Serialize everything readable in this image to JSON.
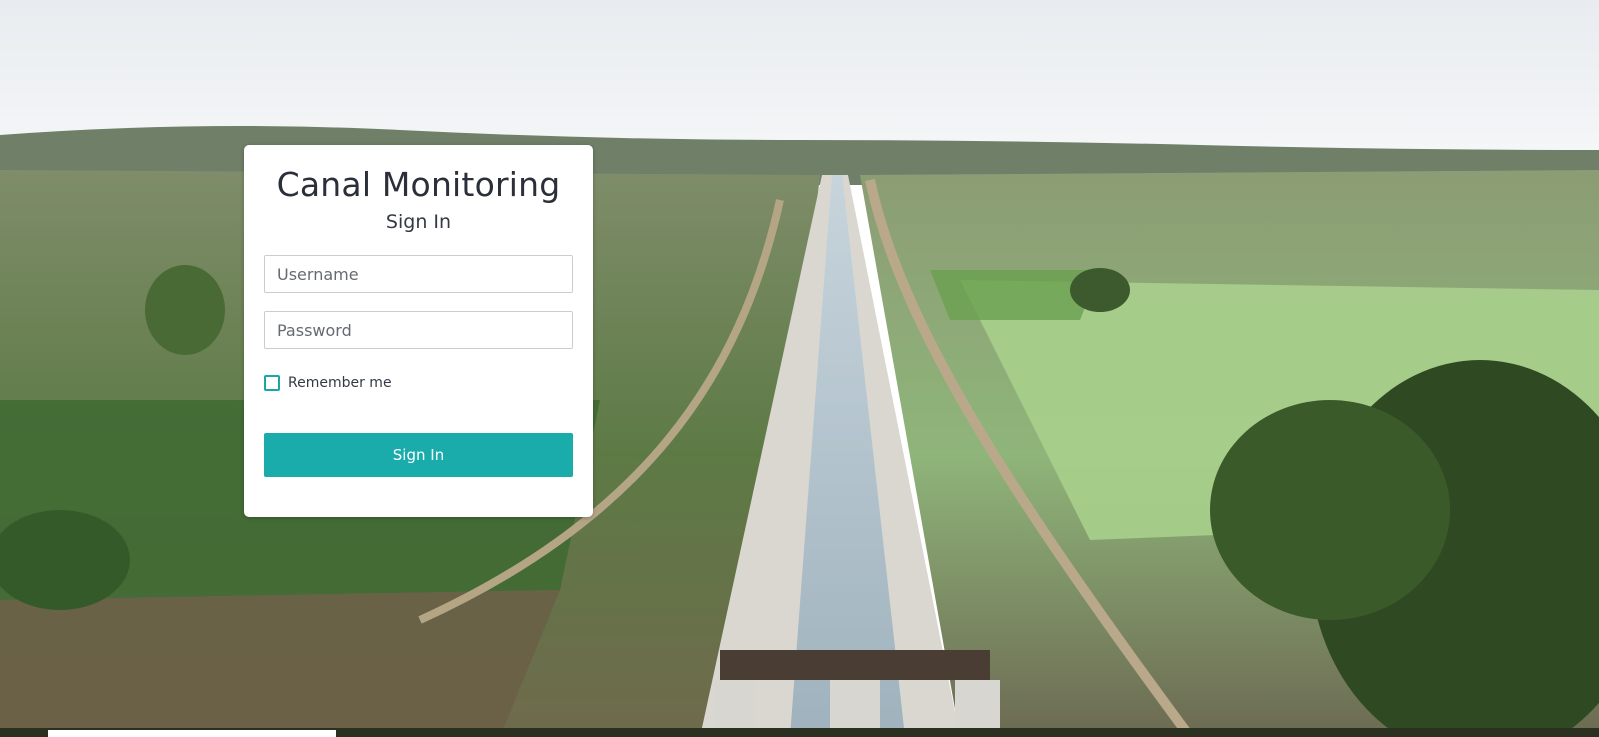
{
  "login": {
    "title": "Canal Monitoring",
    "subtitle": "Sign In",
    "username_placeholder": "Username",
    "password_placeholder": "Password",
    "remember_label": "Remember me",
    "remember_checked": false,
    "submit_label": "Sign In"
  },
  "colors": {
    "accent": "#1aabab",
    "card_background": "#ffffff",
    "title_text": "#2b2f3a"
  },
  "background": {
    "description_icon": "canal-aerial-photo"
  }
}
